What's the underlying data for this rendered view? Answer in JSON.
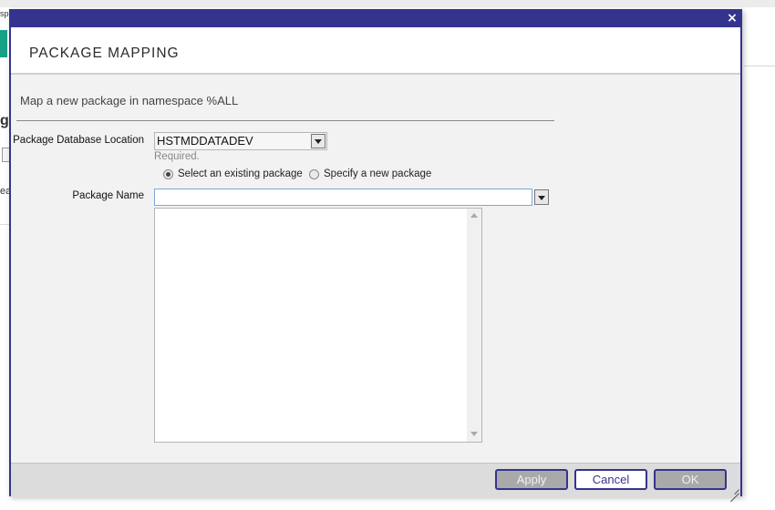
{
  "background": {
    "crumb_text": "sp",
    "heading_fragment": "gs",
    "text_fragment": "ea"
  },
  "dialog": {
    "close_glyph": "×",
    "title": "PACKAGE MAPPING",
    "description": "Map a new package in namespace %ALL",
    "database_location": {
      "label": "Package Database Location",
      "value": "HSTMDDATADEV",
      "required_text": "Required."
    },
    "package_mode": {
      "options": [
        {
          "label": "Select an existing package",
          "checked": true
        },
        {
          "label": "Specify a new package",
          "checked": false
        }
      ]
    },
    "package_name": {
      "label": "Package Name",
      "value": ""
    },
    "buttons": {
      "apply": "Apply",
      "cancel": "Cancel",
      "ok": "OK"
    }
  },
  "colors": {
    "titlebar": "#34348f",
    "accent_teal": "#16a085",
    "disabled_button": "#a9a9a9"
  }
}
